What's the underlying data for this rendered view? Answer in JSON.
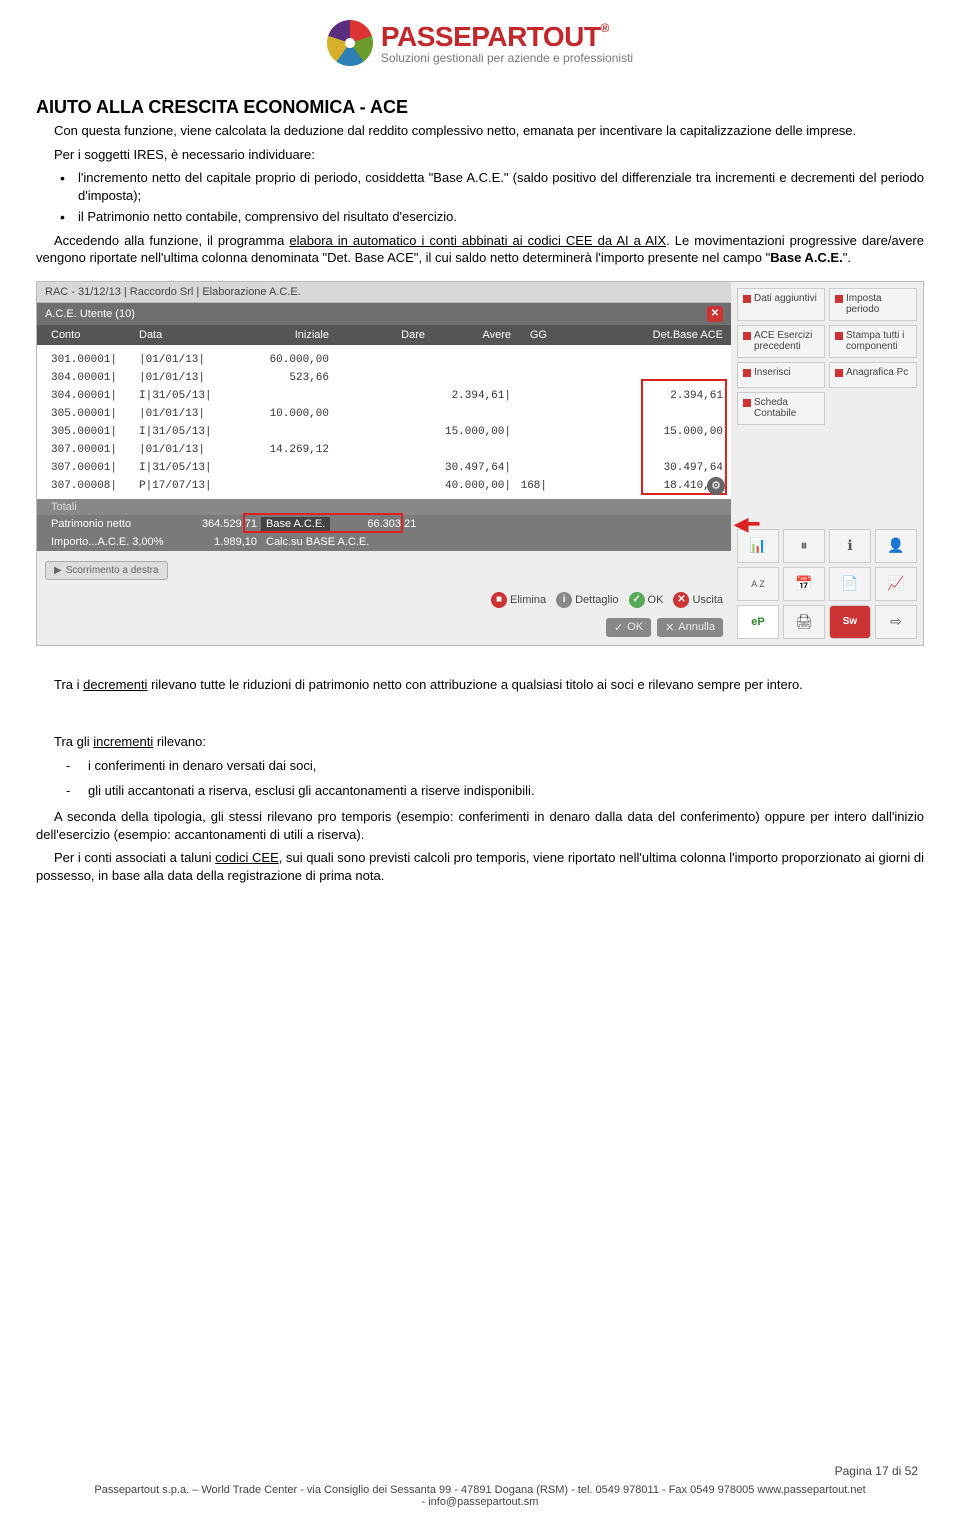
{
  "logo": {
    "name": "PASSEPARTOUT",
    "reg": "®",
    "tagline": "Soluzioni gestionali per aziende e professionisti"
  },
  "title": "AIUTO ALLA CRESCITA ECONOMICA - ACE",
  "p1": "Con questa funzione, viene calcolata la deduzione dal reddito complessivo netto, emanata per incentivare la capitalizzazione delle imprese.",
  "p2": "Per i soggetti IRES, è necessario individuare:",
  "bul1a": "l'incremento netto del capitale proprio di periodo, cosiddetta \"Base A.C.E.\" (saldo positivo del differenziale tra incrementi e decrementi del periodo d'imposta);",
  "bul1b": "il Patrimonio netto contabile, comprensivo del risultato d'esercizio.",
  "p3a": "Accedendo alla funzione, il programma ",
  "p3u": "elabora in automatico i conti abbinati ai codici CEE da AI a AIX",
  "p3b": ". Le movimentazioni progressive dare/avere vengono riportate nell'ultima colonna denominata \"Det. Base ACE\", il cui saldo netto determinerà l'importo presente nel campo \"",
  "p3bold": "Base A.C.E.",
  "p3c": "\".",
  "app": {
    "titlebar": "RAC - 31/12/13 | Raccordo Srl | Elaborazione A.C.E.",
    "subbar": "A.C.E. Utente (10)",
    "headers": {
      "conto": "Conto",
      "data": "Data",
      "iniziale": "Iniziale",
      "dare": "Dare",
      "avere": "Avere",
      "gg": "GG",
      "det": "Det.Base ACE"
    },
    "rows": [
      {
        "conto": "301.00001|",
        "data": "|01/01/13|",
        "iniziale": "60.000,00",
        "dare": "",
        "avere": "",
        "gg": "",
        "det": ""
      },
      {
        "conto": "304.00001|",
        "data": "|01/01/13|",
        "iniziale": "523,66",
        "dare": "",
        "avere": "",
        "gg": "",
        "det": ""
      },
      {
        "conto": "304.00001|",
        "data": "I|31/05/13|",
        "iniziale": "",
        "dare": "",
        "avere": "2.394,61|",
        "gg": "",
        "det": "2.394,61"
      },
      {
        "conto": "305.00001|",
        "data": "|01/01/13|",
        "iniziale": "10.000,00",
        "dare": "",
        "avere": "",
        "gg": "",
        "det": ""
      },
      {
        "conto": "305.00001|",
        "data": "I|31/05/13|",
        "iniziale": "",
        "dare": "",
        "avere": "15.000,00|",
        "gg": "",
        "det": "15.000,00"
      },
      {
        "conto": "307.00001|",
        "data": "|01/01/13|",
        "iniziale": "14.269,12",
        "dare": "",
        "avere": "",
        "gg": "",
        "det": ""
      },
      {
        "conto": "307.00001|",
        "data": "I|31/05/13|",
        "iniziale": "",
        "dare": "",
        "avere": "30.497,64|",
        "gg": "",
        "det": "30.497,64"
      },
      {
        "conto": "307.00008|",
        "data": "P|17/07/13|",
        "iniziale": "",
        "dare": "",
        "avere": "40.000,00|",
        "gg": "168|",
        "det": "18.410,96"
      }
    ],
    "totali_lbl": "Totali",
    "sum1": {
      "lbl": "Patrimonio netto",
      "val1": "364.529,71",
      "lbl2": "Base A.C.E.",
      "val2": "66.303,21"
    },
    "sum2": {
      "lbl": "Importo...A.C.E. 3,00%",
      "val1": "1.989,10",
      "lbl2": "Calc.su BASE A.C.E."
    },
    "scroll_btn": "Scorrimento a destra",
    "actions": {
      "elimina": "Elimina",
      "dettaglio": "Dettaglio",
      "ok": "OK",
      "uscita": "Uscita",
      "annulla": "Annulla"
    },
    "side": [
      "Dati aggiuntivi",
      "Imposta periodo",
      "ACE Esercizi precedenti",
      "Stampa tutti i componenti",
      "Inserisci",
      "Anagrafica Pc",
      "Scheda Contabile"
    ]
  },
  "p4a": "Tra i ",
  "p4u": "decrementi",
  "p4b": " rilevano tutte le riduzioni di patrimonio netto con attribuzione a qualsiasi titolo ai soci e rilevano sempre per intero.",
  "p5a": "Tra gli ",
  "p5u": "incrementi",
  "p5b": " rilevano:",
  "d1": "i conferimenti in denaro versati dai soci,",
  "d2": "gli utili accantonati a riserva, esclusi gli accantonamenti a riserve indisponibili.",
  "p6": "A seconda della tipologia, gli stessi rilevano pro temporis (esempio: conferimenti in denaro dalla data del conferimento) oppure per intero dall'inizio dell'esercizio (esempio: accantonamenti di utili a riserva).",
  "p7a": "Per i conti associati a taluni ",
  "p7u": "codici CEE",
  "p7b": ", sui quali sono previsti calcoli pro temporis, viene riportato nell'ultima colonna l'importo proporzionato ai giorni di possesso, in base alla data della registrazione di prima nota.",
  "footer": {
    "page": "Pagina 17 di 52",
    "line1": "Passepartout s.p.a. – World Trade Center - via Consiglio dei Sessanta 99 - 47891 Dogana (RSM) - tel. 0549 978011 - Fax 0549 978005 www.passepartout.net",
    "line2": "- info@passepartout.sm"
  }
}
